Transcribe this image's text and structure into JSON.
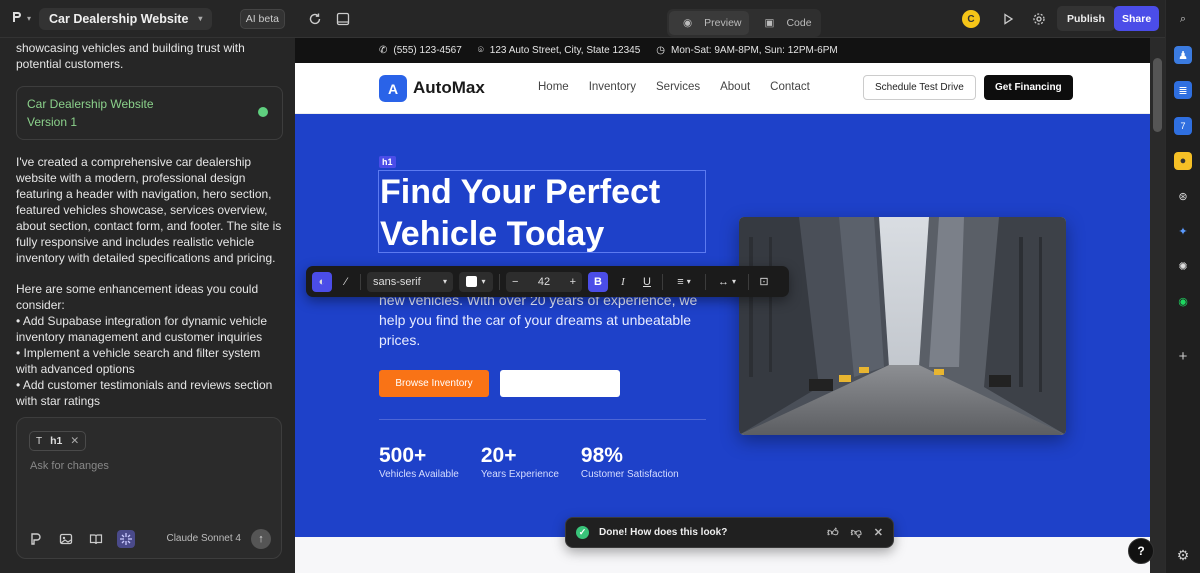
{
  "left": {
    "project_title": "Car Dealership Website",
    "ai_beta": "AI beta",
    "intro": "showcasing vehicles and building trust with potential customers.",
    "version_card": {
      "title": "Car Dealership Website",
      "version": "Version 1"
    },
    "summary": "I've created a comprehensive car dealership website with a modern, professional design featuring a header with navigation, hero section, featured vehicles showcase, services overview, about section, contact form, and footer. The site is fully responsive and includes realistic vehicle inventory with detailed specifications and pricing.",
    "ideas_intro": "Here are some enhancement ideas you could consider:",
    "ideas": [
      "• Add Supabase integration for dynamic vehicle inventory management and customer inquiries",
      "• Implement a vehicle search and filter system with advanced options",
      "• Add customer testimonials and reviews section with star ratings"
    ],
    "composer": {
      "tag": "h1",
      "placeholder": "Ask for changes",
      "model": "Claude Sonnet 4"
    }
  },
  "toolbar": {
    "preview": "Preview",
    "code": "Code",
    "avatar": "C",
    "publish": "Publish",
    "share": "Share"
  },
  "site": {
    "info": {
      "phone": "(555) 123-4567",
      "address": "123 Auto Street, City, State 12345",
      "hours": "Mon-Sat: 9AM-8PM, Sun: 12PM-6PM"
    },
    "brand_letter": "A",
    "brand": "AutoMax",
    "nav": [
      "Home",
      "Inventory",
      "Services",
      "About",
      "Contact"
    ],
    "cta_ghost": "Schedule Test Drive",
    "cta_dark": "Get Financing",
    "hero": {
      "tag": "h1",
      "headline_1": "Find Your Perfect",
      "headline_2": "Vehicle Today",
      "para": "new vehicles. With over 20 years of experience, we help you find the car of your dreams at unbeatable prices.",
      "btn_primary": "Browse Inventory",
      "stats": [
        {
          "num": "500+",
          "label": "Vehicles Available"
        },
        {
          "num": "20+",
          "label": "Years Experience"
        },
        {
          "num": "98%",
          "label": "Customer Satisfaction"
        }
      ]
    }
  },
  "format_bar": {
    "font": "sans-serif",
    "size": "42",
    "bold": "B",
    "italic": "I",
    "underline": "U"
  },
  "toast": {
    "message": "Done! How does this look?"
  },
  "help": "?",
  "colors": {
    "hero": "#1e41c9",
    "accent": "#4b4de8",
    "orange": "#f97316"
  }
}
